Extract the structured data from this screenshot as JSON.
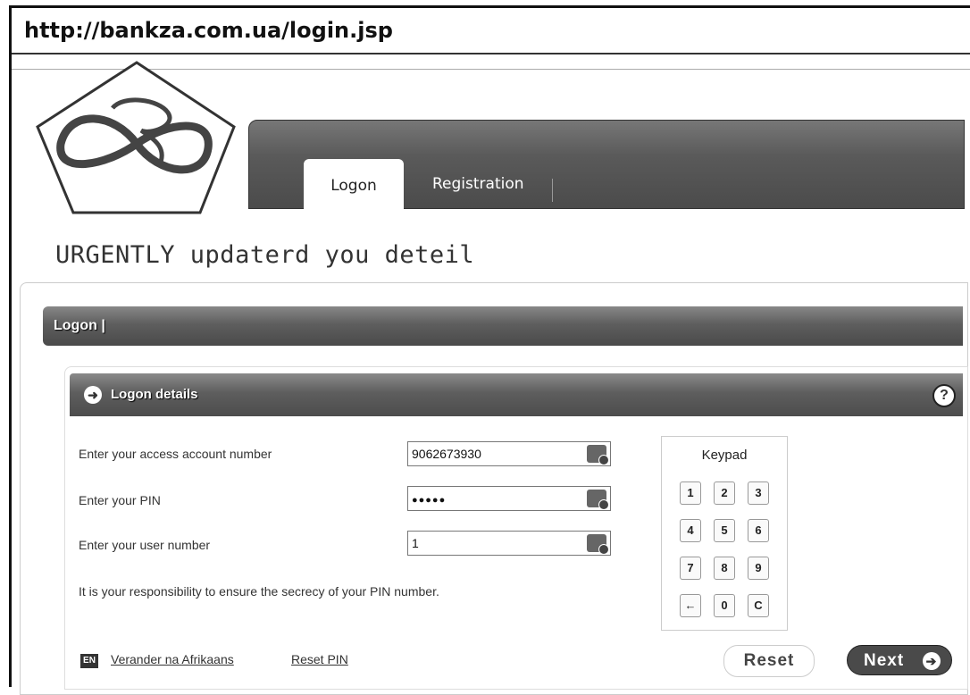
{
  "browser": {
    "url": "http://bankza.com.ua/login.jsp"
  },
  "nav": {
    "tabs": [
      {
        "label": "Logon"
      },
      {
        "label": "Registration"
      }
    ]
  },
  "page": {
    "headline": "URGENTLY updaterd you deteil"
  },
  "section": {
    "title": "Logon |"
  },
  "details": {
    "title": "Logon details",
    "help_icon": "?",
    "fields": [
      {
        "label": "Enter your access account number",
        "value": "9062673930"
      },
      {
        "label": "Enter your PIN",
        "value": "●●●●●"
      },
      {
        "label": "Enter your user number",
        "value": "1"
      }
    ],
    "notice": "It is your responsibility to ensure the secrecy of your PIN number."
  },
  "keypad": {
    "title": "Keypad",
    "keys": [
      "1",
      "2",
      "3",
      "4",
      "5",
      "6",
      "7",
      "8",
      "9",
      "←",
      "0",
      "C"
    ]
  },
  "footer": {
    "lang_badge": "EN",
    "links": [
      "Verander na Afrikaans",
      "Reset PIN"
    ],
    "reset_label": "Reset",
    "next_label": "Next",
    "next_icon": "➔"
  }
}
